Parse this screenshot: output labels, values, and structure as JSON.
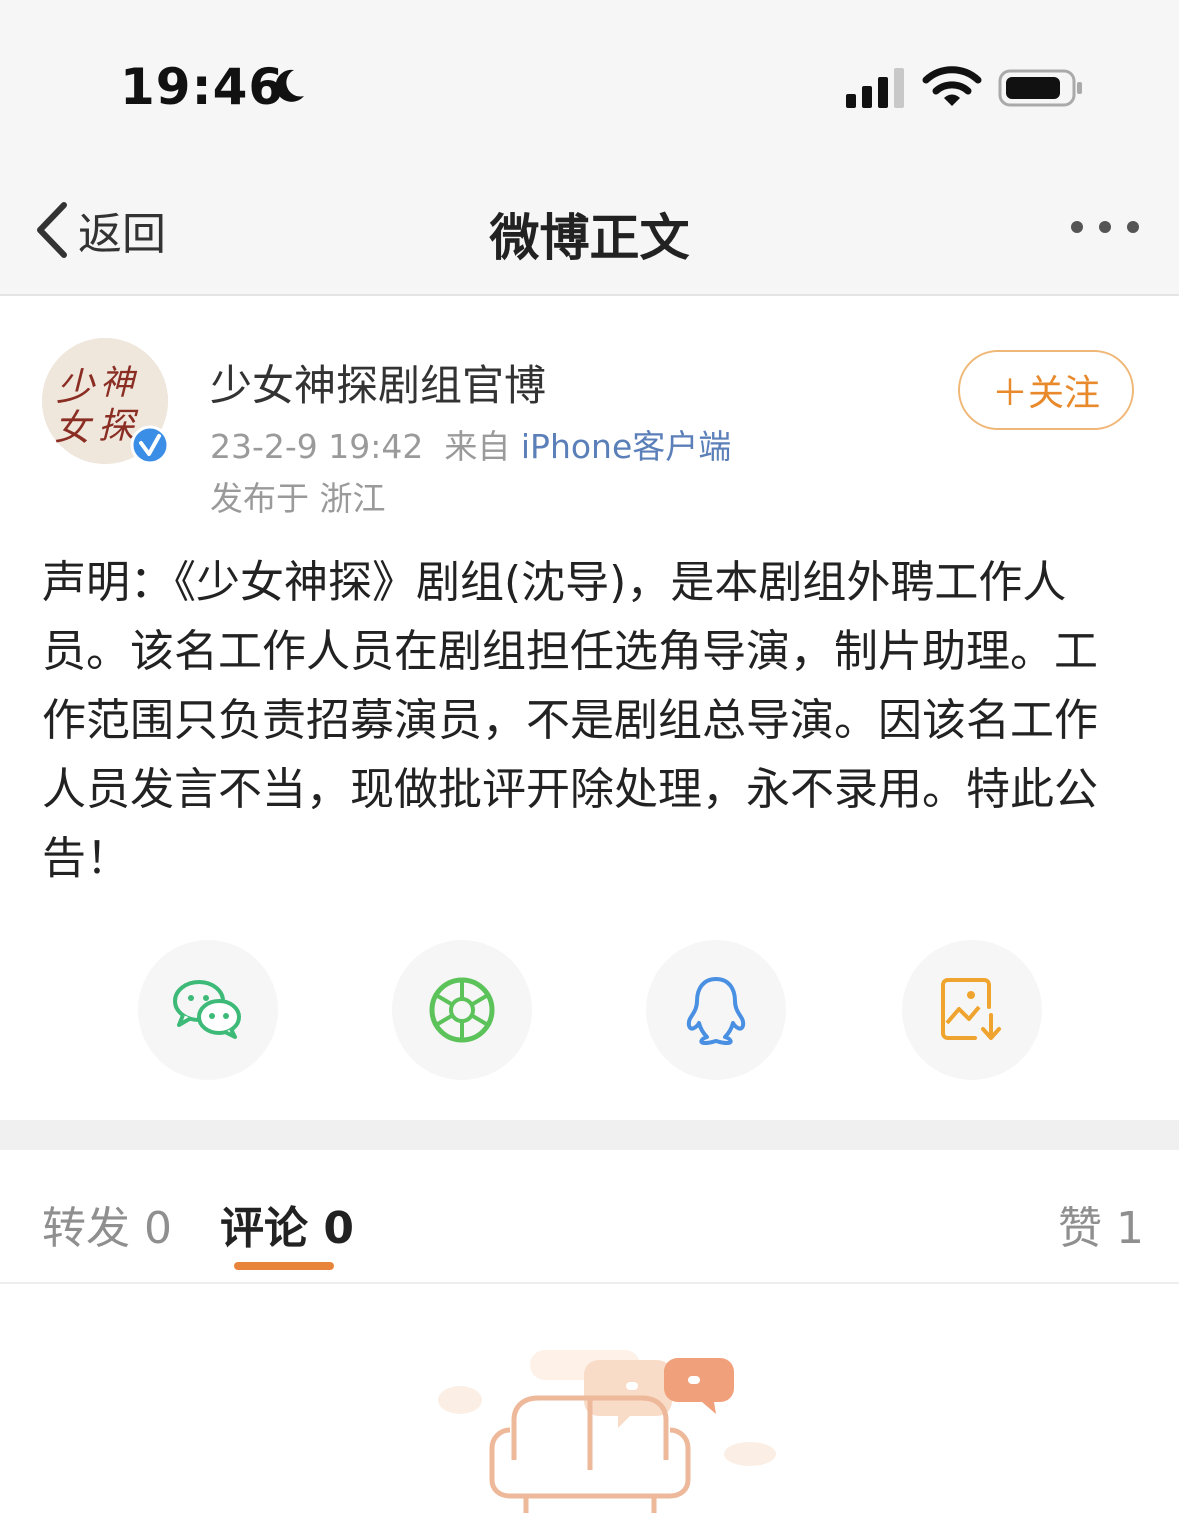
{
  "status_bar": {
    "time": "19:46",
    "icons": [
      "moon-icon",
      "signal-icon",
      "wifi-icon",
      "battery-icon"
    ]
  },
  "nav": {
    "back_label": "返回",
    "title": "微博正文",
    "more_icon": "more-dots-icon"
  },
  "author": {
    "avatar_text": "少女神探",
    "name": "少女神探剧组官博",
    "verified_icon": "verified-badge-icon",
    "date": "23-2-9 19:42",
    "source_prefix": "来自",
    "source": "iPhone客户端",
    "location": "发布于 浙江"
  },
  "follow_button": "＋关注",
  "post": {
    "text": "声明：《少女神探》剧组(沈导)，是本剧组外聘工作人员。该名工作人员在剧组担任选角导演，制片助理。工作范围只负责招募演员，不是剧组总导演。因该名工作人员发言不当，现做批评开除处理，永不录用。特此公告！"
  },
  "share": [
    {
      "icon": "wechat-icon"
    },
    {
      "icon": "moments-icon"
    },
    {
      "icon": "qq-icon"
    },
    {
      "icon": "save-image-icon"
    }
  ],
  "tabs": {
    "repost": "转发 0",
    "comment": "评论 0",
    "like": "赞 1"
  },
  "colors": {
    "accent": "#e8843a",
    "follow_border": "#f0b878",
    "link_blue": "#5b7fb8",
    "wechat_green": "#3dba78",
    "moments_green": "#5cc35a",
    "qq_blue": "#4a90e2",
    "save_orange": "#f0a430"
  }
}
